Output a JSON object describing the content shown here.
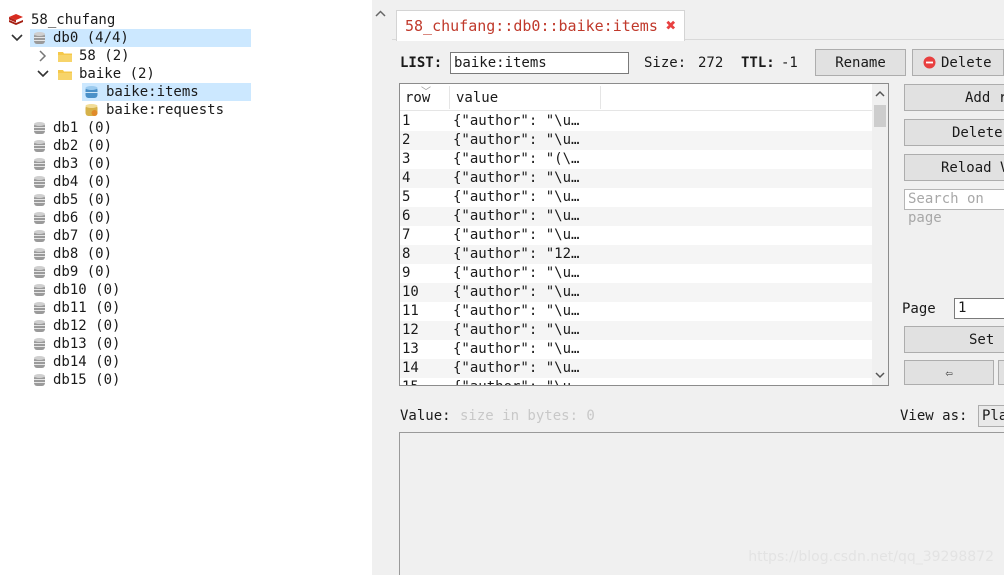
{
  "tree": {
    "connection": "58_chufang",
    "db0": "db0  (4/4)",
    "folder58": "58  (2)",
    "folderBaike": "baike  (2)",
    "keyItems": "baike:items",
    "keyRequests": "baike:requests",
    "dbs": [
      "db1  (0)",
      "db2  (0)",
      "db3  (0)",
      "db4  (0)",
      "db5  (0)",
      "db6  (0)",
      "db7  (0)",
      "db8  (0)",
      "db9  (0)",
      "db10  (0)",
      "db11  (0)",
      "db12  (0)",
      "db13  (0)",
      "db14  (0)",
      "db15  (0)"
    ]
  },
  "tab": {
    "title": "58_chufang::db0::baike:items"
  },
  "key": {
    "type_label": "LIST:",
    "name": "baike:items",
    "size_label": "Size:",
    "size": "272",
    "ttl_label": "TTL:",
    "ttl": "-1",
    "rename": "Rename",
    "delete": "Delete"
  },
  "table": {
    "col_row": "row",
    "col_value": "value",
    "rows": [
      {
        "n": "1",
        "v": "{\"author\": \"\\u…"
      },
      {
        "n": "2",
        "v": "{\"author\": \"\\u…"
      },
      {
        "n": "3",
        "v": "{\"author\": \"(\\…"
      },
      {
        "n": "4",
        "v": "{\"author\": \"\\u…"
      },
      {
        "n": "5",
        "v": "{\"author\": \"\\u…"
      },
      {
        "n": "6",
        "v": "{\"author\": \"\\u…"
      },
      {
        "n": "7",
        "v": "{\"author\": \"\\u…"
      },
      {
        "n": "8",
        "v": "{\"author\": \"12…"
      },
      {
        "n": "9",
        "v": "{\"author\": \"\\u…"
      },
      {
        "n": "10",
        "v": "{\"author\": \"\\u…"
      },
      {
        "n": "11",
        "v": "{\"author\": \"\\u…"
      },
      {
        "n": "12",
        "v": "{\"author\": \"\\u…"
      },
      {
        "n": "13",
        "v": "{\"author\": \"\\u…"
      },
      {
        "n": "14",
        "v": "{\"author\": \"\\u…"
      },
      {
        "n": "15",
        "v": "{\"author\": \"\\u…"
      }
    ]
  },
  "side": {
    "add": "Add row",
    "delete": "Delete row",
    "reload": "Reload Value",
    "search_placeholder": "Search on page",
    "page_label": "Page",
    "page_value": "1",
    "set_page": "Set Page",
    "prev": "⇦"
  },
  "valuebar": {
    "label": "Value:",
    "size_hint": "size in bytes: 0",
    "view_as_label": "View as:",
    "view_as_value": "Plain Text"
  },
  "watermark": "https://blog.csdn.net/qq_39298872",
  "colors": {
    "accent": "#c0392b",
    "selection": "#cce8ff",
    "delete_icon": "#e84040",
    "add_icon": "#2eaa2e"
  }
}
